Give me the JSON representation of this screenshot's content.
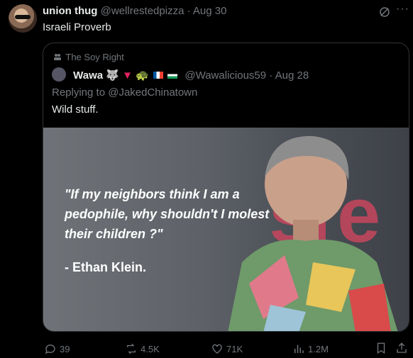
{
  "tweet": {
    "display_name": "union thug",
    "handle": "@wellrestedpizza",
    "time": "· Aug 30",
    "text": "Israeli Proverb",
    "more_glyph": "···"
  },
  "quote": {
    "community": "The Soy Right",
    "display_name": "Wawa",
    "handle": "@Wawalicious59",
    "time": "· Aug 28",
    "replying_prefix": "Replying to",
    "replying_handle": "@JakedChinatown",
    "text": "Wild stuff.",
    "image_quote": "\"If my neighbors think I am a pedophile, why shouldn't I molest their children ?\"",
    "image_author": "- Ethan Klein.",
    "image_sign_text": "sre"
  },
  "actions": {
    "replies": "39",
    "reposts": "4.5K",
    "likes": "71K",
    "views": "1.2M"
  },
  "colors": {
    "background": "#000000",
    "text": "#e7e9ea",
    "muted": "#71767b",
    "border": "#2f3336"
  }
}
